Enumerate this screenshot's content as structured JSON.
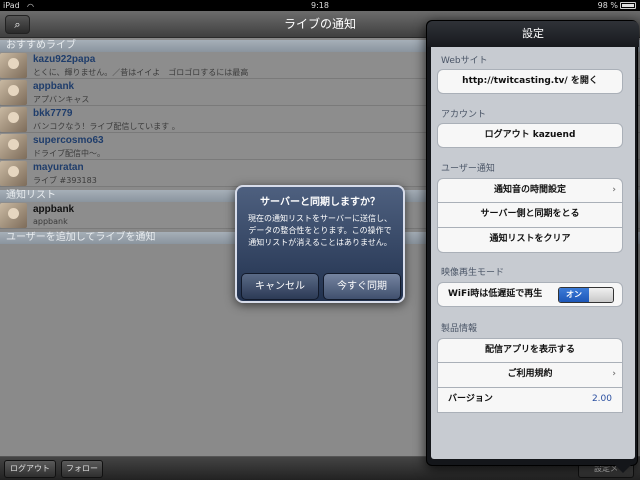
{
  "statusbar": {
    "carrier": "iPad",
    "time": "9:18",
    "battery": "98 %"
  },
  "navbar": {
    "title": "ライブの通知",
    "search_icon": "search-icon"
  },
  "list": {
    "section_recommended": "おすすめライブ",
    "recommended": [
      {
        "name": "kazu922papa",
        "sub": "とくに、輝りません。／昔はイイよ　ゴロゴロするには最高"
      },
      {
        "name": "appbank",
        "sub": "アプバンキャス"
      },
      {
        "name": "bkk7779",
        "sub": "バンコクなう！ライブ配信しています 。"
      },
      {
        "name": "supercosmo63",
        "sub": "ドライブ配信中～。"
      },
      {
        "name": "mayuratan",
        "sub": "ライブ #393183"
      }
    ],
    "section_notify": "通知リスト",
    "notify": [
      {
        "name": "appbank",
        "sub": "appbank"
      }
    ],
    "section_add": "ユーザーを追加してライブを通知"
  },
  "toolbar": {
    "logout": "ログアウト",
    "follow": "フォロー",
    "settings": "設定メ"
  },
  "alert": {
    "title": "サーバーと同期しますか？",
    "message": "現在の通知リストをサーバーに送信し、データの整合性をとります。この操作で通知リストが消えることはありません。",
    "cancel": "キャンセル",
    "ok": "今すぐ同期"
  },
  "settings": {
    "title": "設定",
    "website_header": "Webサイト",
    "website_button": "http://twitcasting.tv/ を開く",
    "account_header": "アカウント",
    "logout_button": "ログアウト kazuend",
    "notify_header": "ユーザー通知",
    "notify_time": "通知音の時間設定",
    "server_sync": "サーバー側と同期をとる",
    "clear_list": "通知リストをクリア",
    "video_header": "映像再生モード",
    "wifi_label": "WiFi時は低遅延で再生",
    "switch_on": "オン",
    "product_header": "製品情報",
    "show_app": "配信アプリを表示する",
    "terms": "ご利用規約",
    "version_label": "バージョン",
    "version_value": "2.00"
  }
}
